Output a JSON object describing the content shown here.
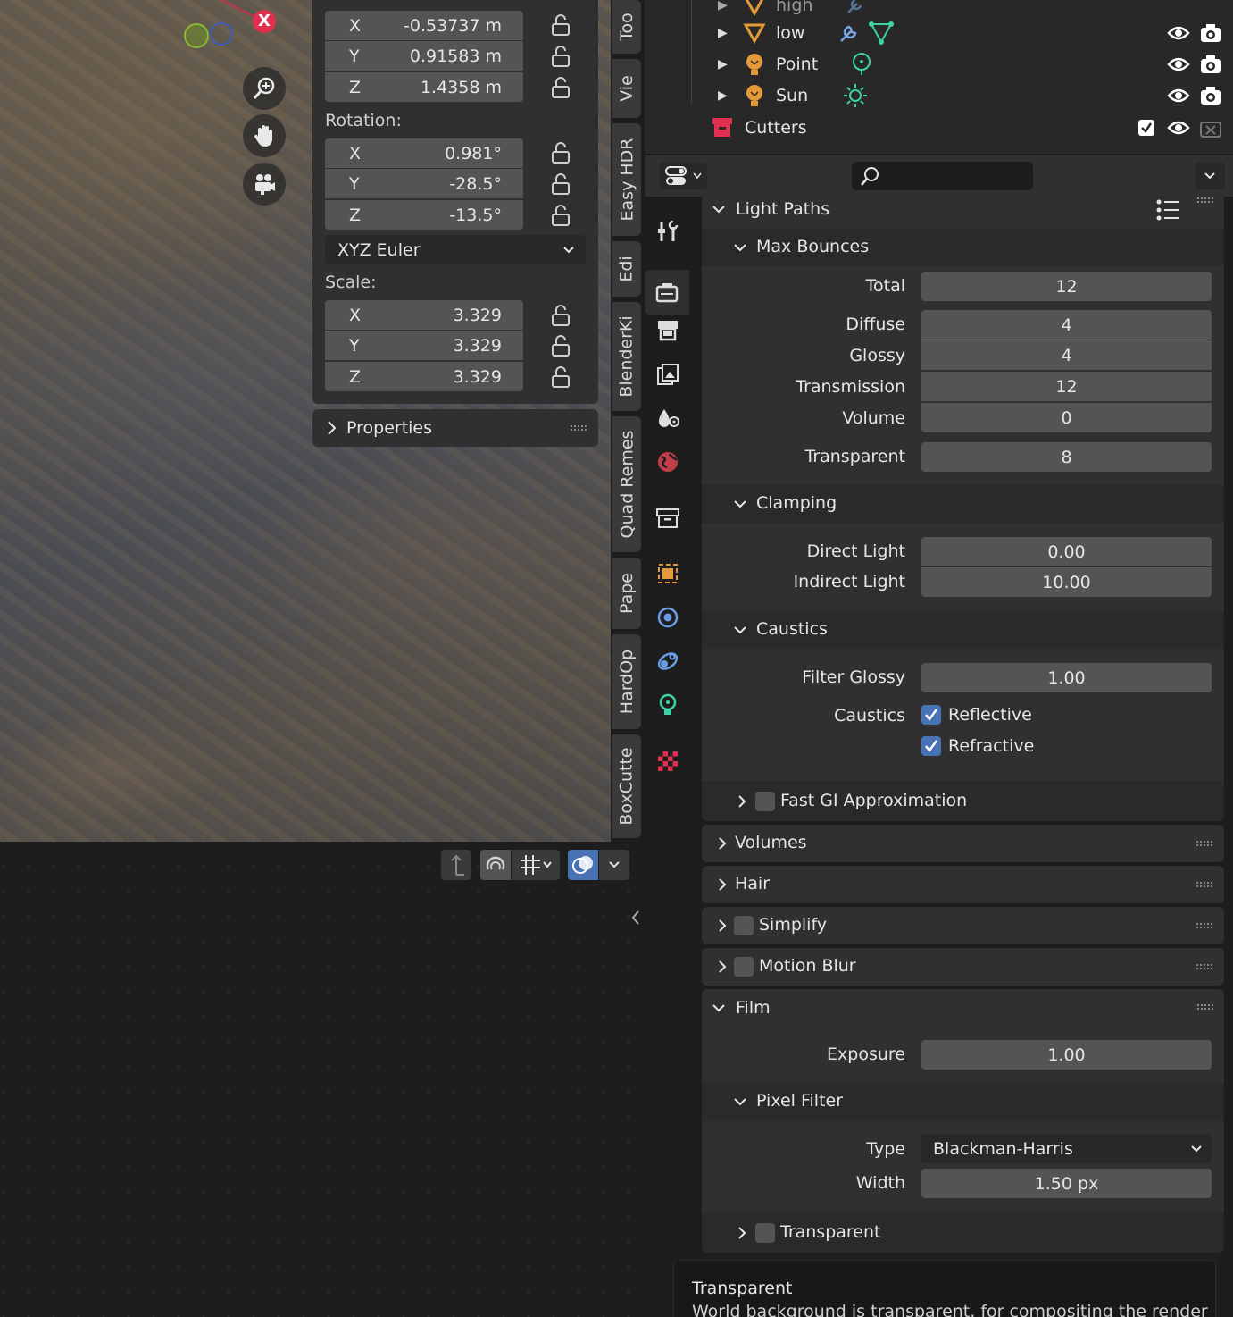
{
  "viewport": {
    "gizmo_x_label": "X",
    "npanel": {
      "location": {
        "x": "-0.53737 m",
        "y": "0.91583 m",
        "z": "1.4358 m"
      },
      "rotation_label": "Rotation:",
      "rotation": {
        "x": "0.981°",
        "y": "-28.5°",
        "z": "-13.5°"
      },
      "rotation_mode": "XYZ Euler",
      "scale_label": "Scale:",
      "scale": {
        "x": "3.329",
        "y": "3.329",
        "z": "3.329"
      },
      "axis_x": "X",
      "axis_y": "Y",
      "axis_z": "Z",
      "properties_label": "Properties"
    },
    "tabs": [
      "Too",
      "Vie",
      "Easy HDR",
      "Edi",
      "BlenderKi",
      "Quad Remes",
      "Pape",
      "HardOp",
      "BoxCutte"
    ]
  },
  "outliner": {
    "rows": [
      {
        "name": "high"
      },
      {
        "name": "low"
      },
      {
        "name": "Point"
      },
      {
        "name": "Sun"
      },
      {
        "name": "Cutters"
      }
    ]
  },
  "properties": {
    "search_placeholder": "",
    "light_paths": {
      "title": "Light Paths",
      "max_bounces": {
        "title": "Max Bounces",
        "rows": [
          {
            "label": "Total",
            "value": "12"
          },
          {
            "label": "Diffuse",
            "value": "4"
          },
          {
            "label": "Glossy",
            "value": "4"
          },
          {
            "label": "Transmission",
            "value": "12"
          },
          {
            "label": "Volume",
            "value": "0"
          },
          {
            "label": "Transparent",
            "value": "8"
          }
        ]
      },
      "clamping": {
        "title": "Clamping",
        "direct_label": "Direct Light",
        "direct_value": "0.00",
        "indirect_label": "Indirect Light",
        "indirect_value": "10.00"
      },
      "caustics": {
        "title": "Caustics",
        "filter_label": "Filter Glossy",
        "filter_value": "1.00",
        "caustics_label": "Caustics",
        "reflective": "Reflective",
        "refractive": "Refractive"
      },
      "fast_gi": "Fast GI Approximation"
    },
    "volumes": "Volumes",
    "hair": "Hair",
    "simplify": "Simplify",
    "motion_blur": "Motion Blur",
    "film": {
      "title": "Film",
      "exposure_label": "Exposure",
      "exposure_value": "1.00",
      "pixel_filter": {
        "title": "Pixel Filter",
        "type_label": "Type",
        "type_value": "Blackman-Harris",
        "width_label": "Width",
        "width_value": "1.50 px"
      },
      "transparent": "Transparent"
    }
  },
  "tooltip": {
    "title": "Transparent",
    "body": "World background is transparent, for compositing the render"
  },
  "colors": {
    "accent": "#4772b3",
    "panel": "#303030",
    "field": "#545454"
  }
}
